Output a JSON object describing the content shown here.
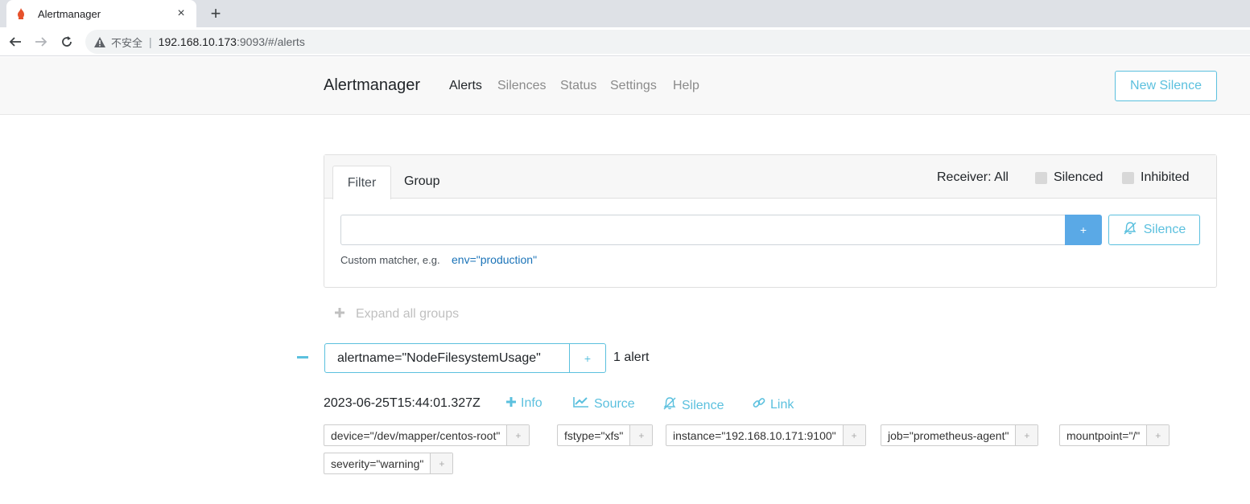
{
  "browser": {
    "tab_title": "Alertmanager",
    "tab_close": "×",
    "new_tab": "+",
    "insecure_label": "不安全",
    "url_host": "192.168.10.173",
    "url_rest": ":9093/#/alerts"
  },
  "navbar": {
    "brand": "Alertmanager",
    "links": [
      "Alerts",
      "Silences",
      "Status",
      "Settings",
      "Help"
    ],
    "new_silence": "New Silence"
  },
  "filter": {
    "tabs": [
      "Filter",
      "Group"
    ],
    "receiver": "Receiver: All",
    "silenced_label": "Silenced",
    "inhibited_label": "Inhibited",
    "input_value": "",
    "add_button": "+",
    "silence_button": "Silence",
    "hint": "Custom matcher, e.g.",
    "hint_example": "env=\"production\""
  },
  "expand_all": "Expand all groups",
  "group": {
    "label": "alertname=\"NodeFilesystemUsage\"",
    "add": "+",
    "count": "1 alert",
    "alert": {
      "time": "2023-06-25T15:44:01.327Z",
      "actions": [
        "Info",
        "Source",
        "Silence",
        "Link"
      ],
      "labels": [
        "device=\"/dev/mapper/centos-root\"",
        "fstype=\"xfs\"",
        "instance=\"192.168.10.171:9100\"",
        "job=\"prometheus-agent\"",
        "mountpoint=\"/\"",
        "severity=\"warning\""
      ],
      "label_add": "+"
    }
  },
  "colors": {
    "accent": "#5bc0de",
    "primary_button": "#5aa9e6",
    "link": "#1a73b8"
  }
}
